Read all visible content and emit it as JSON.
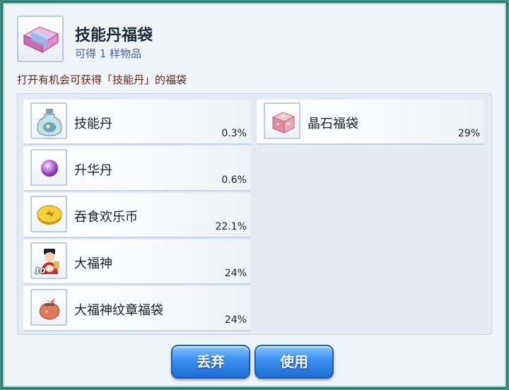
{
  "header": {
    "icon": "gift-bag-icon",
    "title": "技能丹福袋",
    "subtitle": "可得 1 样物品"
  },
  "description": "打开有机会可获得「技能丹」的福袋",
  "items": [
    {
      "name": "技能丹",
      "percent": "0.3%",
      "icon": "potion-bottle-icon"
    },
    {
      "name": "升华丹",
      "percent": "0.6%",
      "icon": "purple-orb-icon"
    },
    {
      "name": "吞食欢乐币",
      "percent": "22.1%",
      "icon": "gold-coin-icon"
    },
    {
      "name": "大福神",
      "percent": "24%",
      "icon": "fortune-god-icon",
      "quantity": "10"
    },
    {
      "name": "大福神纹章福袋",
      "percent": "24%",
      "icon": "cloth-pouch-icon"
    },
    {
      "name": "晶石福袋",
      "percent": "29%",
      "icon": "pink-crystal-box-icon"
    }
  ],
  "buttons": {
    "discard": "丢弃",
    "use": "使用"
  }
}
